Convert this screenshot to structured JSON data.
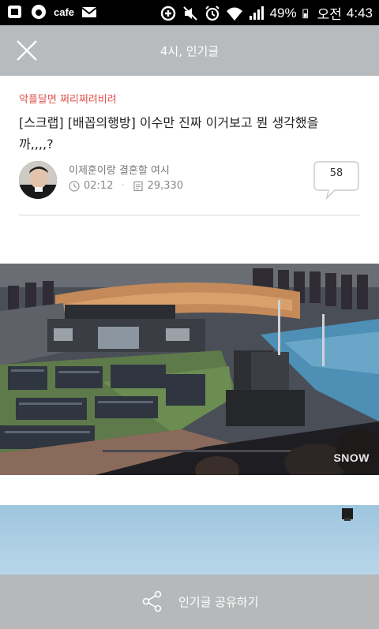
{
  "status_bar": {
    "app_label": "cafe",
    "battery": "49%",
    "ampm": "오전",
    "time": "4:43"
  },
  "app_bar": {
    "title": "4시, 인기글"
  },
  "post": {
    "board": "악플달면 쩌리쩌려비려",
    "title": "[스크랩] [배꼽의행방] 이수만 진짜 이거보고 뭔 생각했을까,,,,?",
    "author": "이제훈이랑 결혼할 여시",
    "time": "02:12",
    "views": "29,330",
    "comment_count": "58"
  },
  "image": {
    "watermark": "SNOW"
  },
  "bottom_bar": {
    "share_label": "인기글 공유하기"
  }
}
